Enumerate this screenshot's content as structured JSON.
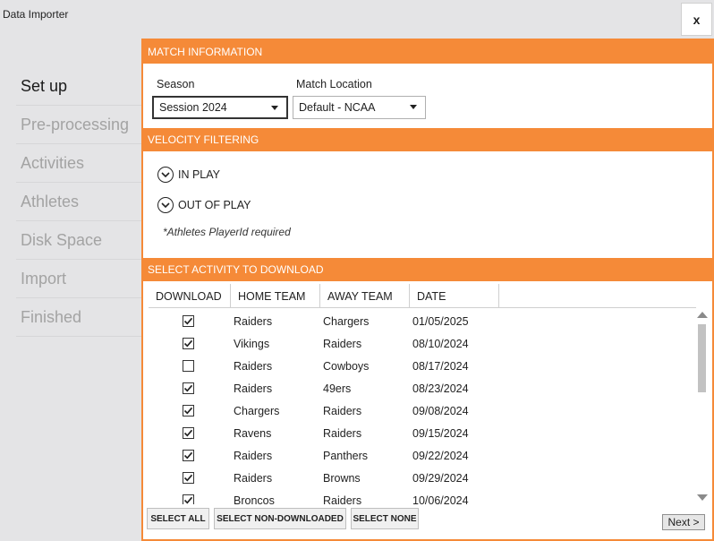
{
  "window": {
    "title": "Data Importer",
    "close_label": "x"
  },
  "steps": [
    {
      "label": "Set up",
      "active": true
    },
    {
      "label": "Pre-processing",
      "active": false
    },
    {
      "label": "Activities",
      "active": false
    },
    {
      "label": "Athletes",
      "active": false
    },
    {
      "label": "Disk Space",
      "active": false
    },
    {
      "label": "Import",
      "active": false
    },
    {
      "label": "Finished",
      "active": false
    }
  ],
  "match_info": {
    "header": "MATCH INFORMATION",
    "season_label": "Season",
    "season_value": "Session 2024",
    "location_label": "Match Location",
    "location_value": "Default - NCAA"
  },
  "velocity": {
    "header": "VELOCITY FILTERING",
    "in_play": "IN PLAY",
    "out_of_play": "OUT OF PLAY",
    "note": "*Athletes PlayerId required"
  },
  "activities": {
    "header": "SELECT ACTIVITY TO DOWNLOAD",
    "columns": [
      "DOWNLOAD",
      "HOME TEAM",
      "AWAY TEAM",
      "DATE"
    ],
    "rows": [
      {
        "checked": true,
        "home": "Raiders",
        "away": "Chargers",
        "date": "01/05/2025"
      },
      {
        "checked": true,
        "home": "Vikings",
        "away": "Raiders",
        "date": "08/10/2024"
      },
      {
        "checked": false,
        "home": "Raiders",
        "away": "Cowboys",
        "date": "08/17/2024"
      },
      {
        "checked": true,
        "home": "Raiders",
        "away": "49ers",
        "date": "08/23/2024"
      },
      {
        "checked": true,
        "home": "Chargers",
        "away": "Raiders",
        "date": "09/08/2024"
      },
      {
        "checked": true,
        "home": "Ravens",
        "away": "Raiders",
        "date": "09/15/2024"
      },
      {
        "checked": true,
        "home": "Raiders",
        "away": "Panthers",
        "date": "09/22/2024"
      },
      {
        "checked": true,
        "home": "Raiders",
        "away": "Browns",
        "date": "09/29/2024"
      },
      {
        "checked": true,
        "home": "Broncos",
        "away": "Raiders",
        "date": "10/06/2024"
      }
    ]
  },
  "buttons": {
    "select_all": "SELECT ALL",
    "select_non_downloaded": "SELECT NON-DOWNLOADED",
    "select_none": "SELECT NONE",
    "next": "Next >"
  },
  "colors": {
    "accent": "#f58a38",
    "background": "#e4e4e6"
  }
}
